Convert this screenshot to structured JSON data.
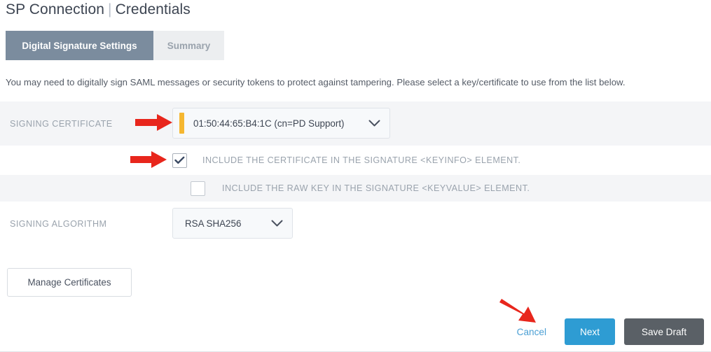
{
  "header": {
    "title_primary": "SP Connection",
    "divider": "|",
    "title_secondary": "Credentials"
  },
  "tabs": [
    {
      "label": "Digital Signature Settings",
      "active": true
    },
    {
      "label": "Summary",
      "active": false
    }
  ],
  "intro": {
    "text": "You may need to digitally sign SAML messages or security tokens to protect against tampering. Please select a key/certificate to use from the list below."
  },
  "form": {
    "signing_certificate": {
      "label": "SIGNING CERTIFICATE",
      "selected_value": "01:50:44:65:B4:1C (cn=PD Support)",
      "accent_color": "#f5b731",
      "chevron_icon": "chevron-down-icon"
    },
    "include_certificate": {
      "label": "INCLUDE THE CERTIFICATE IN THE SIGNATURE <KEYINFO> ELEMENT.",
      "checked": true,
      "check_icon": "checkmark-icon"
    },
    "include_raw_key": {
      "label": "INCLUDE THE RAW KEY IN THE SIGNATURE <KEYVALUE> ELEMENT.",
      "checked": false
    },
    "signing_algorithm": {
      "label": "SIGNING ALGORITHM",
      "selected_value": "RSA SHA256",
      "chevron_icon": "chevron-down-icon"
    }
  },
  "buttons": {
    "manage_certificates": "Manage Certificates",
    "cancel": "Cancel",
    "next": "Next",
    "save_draft": "Save Draft"
  },
  "colors": {
    "tab_active_bg": "#7b8c9e",
    "tab_inactive_bg": "#eceef0",
    "next_button_bg": "#2e9cd3",
    "save_draft_bg": "#5a6066",
    "cancel_link": "#4a9fd4",
    "row_shaded_bg": "#f4f5f7",
    "annotation_arrow": "#e8261c"
  },
  "annotations": [
    {
      "name": "arrow-to-signing-certificate",
      "direction": "right"
    },
    {
      "name": "arrow-to-include-certificate-checkbox",
      "direction": "right"
    },
    {
      "name": "arrow-to-next-button",
      "direction": "down-right"
    }
  ]
}
